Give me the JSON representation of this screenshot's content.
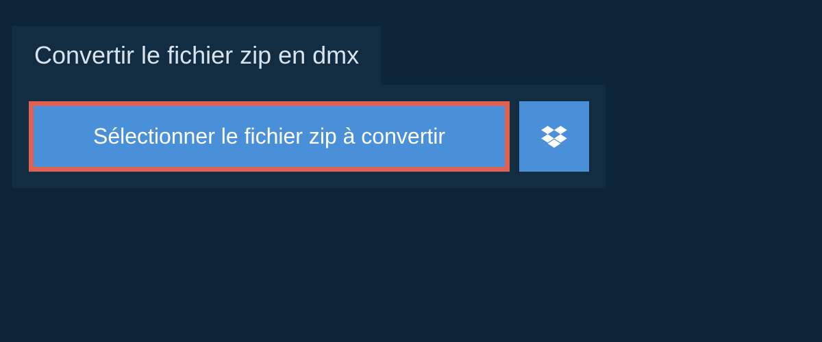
{
  "title": "Convertir le fichier zip en dmx",
  "selectButton": {
    "label": "Sélectionner le fichier zip à convertir"
  },
  "dropbox": {
    "iconName": "dropbox-icon"
  },
  "colors": {
    "background": "#0d2538",
    "panel": "#122c42",
    "buttonBg": "#4a90d9",
    "highlightBorder": "#e06052",
    "textLight": "#d8e4ed"
  }
}
